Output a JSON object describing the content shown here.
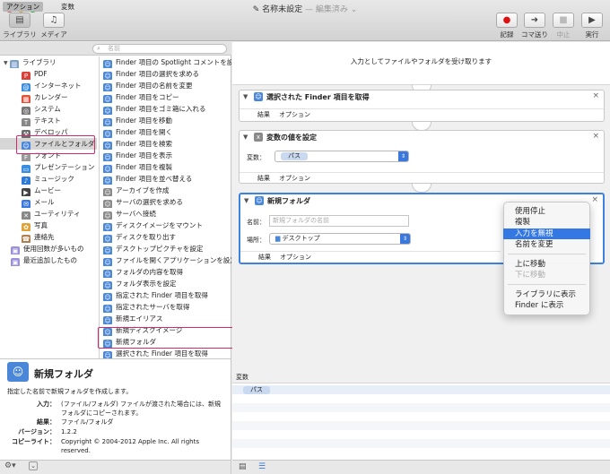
{
  "window": {
    "title": "名称未設定",
    "subtitle": "— 編集済み ⌄",
    "traffic_colors": [
      "#fc605b",
      "#fdbc40",
      "#34c84a"
    ]
  },
  "toolbar": {
    "library_label": "ライブラリ",
    "media_label": "メディア",
    "record_label": "記録",
    "step_label": "コマ送り",
    "stop_label": "中止",
    "run_label": "実行"
  },
  "tabs": {
    "actions": "アクション",
    "variables": "変数"
  },
  "search": {
    "placeholder": "名前"
  },
  "library": {
    "root": "ライブラリ",
    "items": [
      "PDF",
      "インターネット",
      "カレンダー",
      "システム",
      "テキスト",
      "デベロッパ",
      "ファイルとフォルダ",
      "フォント",
      "プレゼンテーション",
      "ミュージック",
      "ムービー",
      "メール",
      "ユーティリティ",
      "写真",
      "連絡先"
    ],
    "extra": [
      "使用回数が多いもの",
      "最近追加したもの"
    ]
  },
  "actions": [
    "Finder 項目の Spotlight コメントを設定",
    "Finder 項目の選択を求める",
    "Finder 項目の名前を変更",
    "Finder 項目をコピー",
    "Finder 項目をゴミ箱に入れる",
    "Finder 項目を移動",
    "Finder 項目を開く",
    "Finder 項目を検索",
    "Finder 項目を表示",
    "Finder 項目を複製",
    "Finder 項目を並べ替える",
    "アーカイブを作成",
    "サーバの選択を求める",
    "サーバへ接続",
    "ディスクイメージをマウント",
    "ディスクを取り出す",
    "デスクトップピクチャを設定",
    "ファイルを開くアプリケーションを設定",
    "フォルダの内容を取得",
    "フォルダ表示を設定",
    "指定された Finder 項目を取得",
    "指定されたサーバを取得",
    "新規エイリアス",
    "新規ディスクイメージ",
    "新規フォルダ",
    "選択された Finder 項目を取得"
  ],
  "description": {
    "title": "新規フォルダ",
    "summary": "指定した名前で新規フォルダを作成します。",
    "input_key": "入力：",
    "input_val": "(ファイル/フォルダ) ファイルが渡された場合には、新規フォルダにコピーされます。",
    "result_key": "結果：",
    "result_val": "ファイル/フォルダ",
    "version_key": "バージョン：",
    "version_val": "1.2.2",
    "copyright_key": "コピーライト：",
    "copyright_val": "Copyright © 2004-2012 Apple Inc.  All rights reserved."
  },
  "workflow": {
    "receive": "入力としてファイルやフォルダを受け取ります",
    "result_tab": "結果",
    "options_tab": "オプション",
    "card1_title": "選択された Finder 項目を取得",
    "card2_title": "変数の値を設定",
    "card2_var_label": "変数：",
    "card2_var_value": "パス",
    "card3_title": "新規フォルダ",
    "card3_name_label": "名前：",
    "card3_name_placeholder": "新規フォルダの名前",
    "card3_place_label": "場所：",
    "card3_place_value": "デスクトップ",
    "close_glyph": "×"
  },
  "variables": {
    "header": "変数",
    "token": "パス"
  },
  "context_menu": {
    "items": [
      "使用停止",
      "複製",
      "入力を無視",
      "名前を変更",
      "上に移動",
      "下に移動",
      "ライブラリに表示",
      "Finder に表示"
    ]
  }
}
